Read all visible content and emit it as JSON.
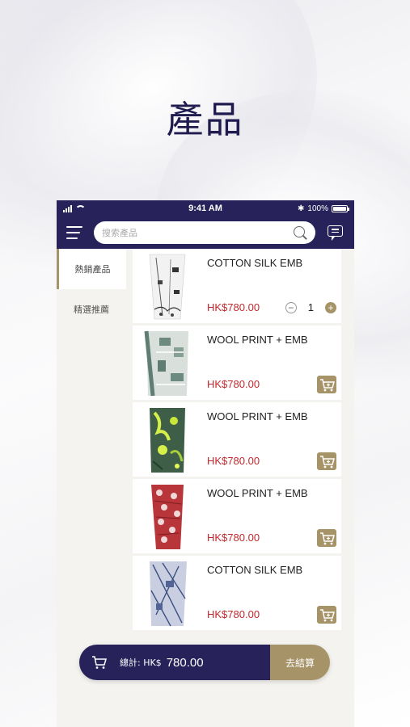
{
  "page_title": "產品",
  "status_bar": {
    "time": "9:41 AM",
    "battery": "100%"
  },
  "search": {
    "placeholder": "搜索產品"
  },
  "sidebar": {
    "items": [
      {
        "label": "熱銷產品",
        "active": true
      },
      {
        "label": "精選推薦",
        "active": false
      }
    ]
  },
  "products": [
    {
      "name": "COTTON SILK EMB",
      "price": "HK$780.00",
      "quantity": "1",
      "image": "white scarf with dark print"
    },
    {
      "name": "WOOL PRINT + EMB",
      "price": "HK$780.00",
      "image": "grey-green geometric scarf"
    },
    {
      "name": "WOOL PRINT + EMB",
      "price": "HK$780.00",
      "image": "green and lime floral scarf"
    },
    {
      "name": "WOOL PRINT + EMB",
      "price": "HK$780.00",
      "image": "red patterned scarf"
    },
    {
      "name": "COTTON SILK EMB",
      "price": "HK$780.00",
      "image": "blue line print scarf"
    }
  ],
  "cart": {
    "total_label": "總計: HK$",
    "total_amount": "780.00",
    "checkout_label": "去結算"
  },
  "colors": {
    "navy": "#27225a",
    "gold": "#a69368",
    "price_red": "#c0282d"
  }
}
